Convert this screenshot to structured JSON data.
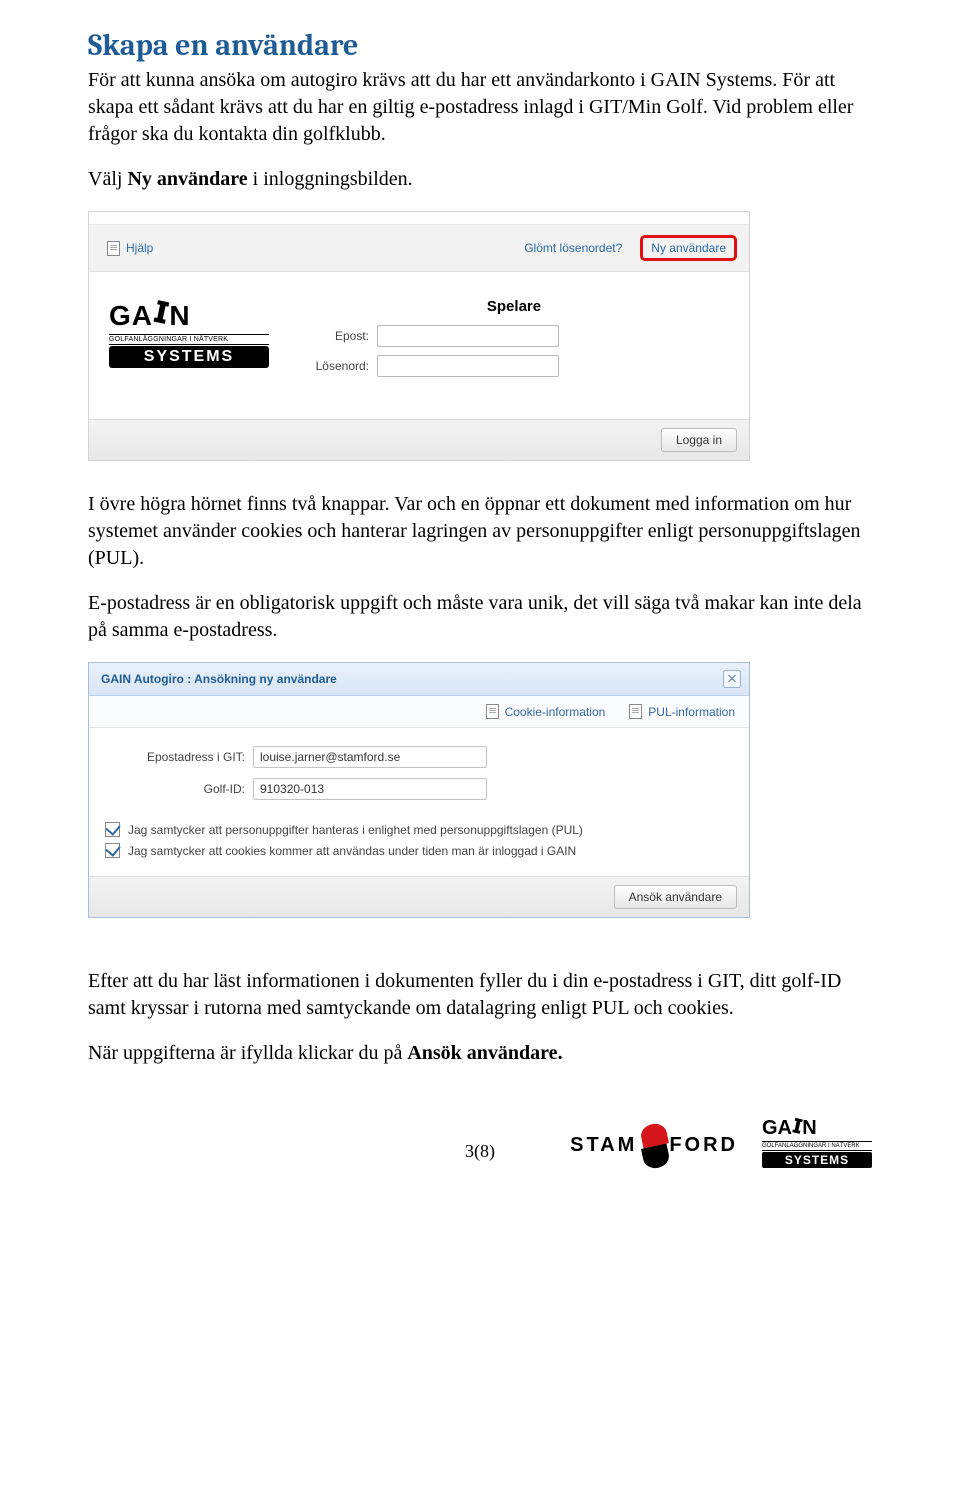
{
  "heading": "Skapa en användare",
  "intro": {
    "p1": "För att kunna ansöka om autogiro krävs att du har ett användarkonto i GAIN Systems. För att skapa ett sådant krävs att du har en giltig e-postadress inlagd i GIT/Min Golf. Vid problem eller frågor ska du kontakta din golfklubb.",
    "p2a": "Välj ",
    "p2b": "Ny användare",
    "p2c": " i inloggningsbilden."
  },
  "shot1": {
    "help": "Hjälp",
    "forgot": "Glömt lösenordet?",
    "newuser": "Ny användare",
    "formtitle": "Spelare",
    "email_label": "Epost:",
    "pwd_label": "Lösenord:",
    "login_btn": "Logga in",
    "logo_top": "GA",
    "logo_top2": "N",
    "logo_mid": "GOLFANLÄGGNINGAR I NÄTVERK",
    "logo_sys": "SYSTEMS"
  },
  "mid": {
    "p1": "I övre högra hörnet finns två knappar. Var och en öppnar ett dokument med information om hur systemet använder cookies och hanterar lagringen av personuppgifter enligt personuppgiftslagen (PUL).",
    "p2": "E-postadress är en obligatorisk uppgift och måste vara unik, det vill säga två makar kan inte dela på samma e-postadress."
  },
  "dialog": {
    "title": "GAIN Autogiro : Ansökning ny användare",
    "cookie": "Cookie-information",
    "pul": "PUL-information",
    "email_label": "Epostadress i GIT:",
    "email_value": "louise.jarner@stamford.se",
    "golfid_label": "Golf-ID:",
    "golfid_value": "910320-013",
    "chk1": "Jag samtycker att personuppgifter hanteras i enlighet med personuppgiftslagen (PUL)",
    "chk2": "Jag samtycker att cookies kommer att användas under tiden man är inloggad i GAIN",
    "apply_btn": "Ansök användare"
  },
  "after": {
    "p1": "Efter att du har läst informationen i dokumenten fyller du i din e-postadress i GIT, ditt golf-ID samt kryssar i rutorna med samtyckande om datalagring enligt PUL och cookies.",
    "p2a": "När uppgifterna är ifyllda klickar du på ",
    "p2b": "Ansök användare."
  },
  "footer": {
    "page": "3(8)",
    "stamford": "STAMFORD",
    "gain_top1": "GA",
    "gain_top2": "N",
    "gain_mid": "GOLFANLÄGGNINGAR I NÄTVERK",
    "gain_sys": "SYSTEMS"
  }
}
